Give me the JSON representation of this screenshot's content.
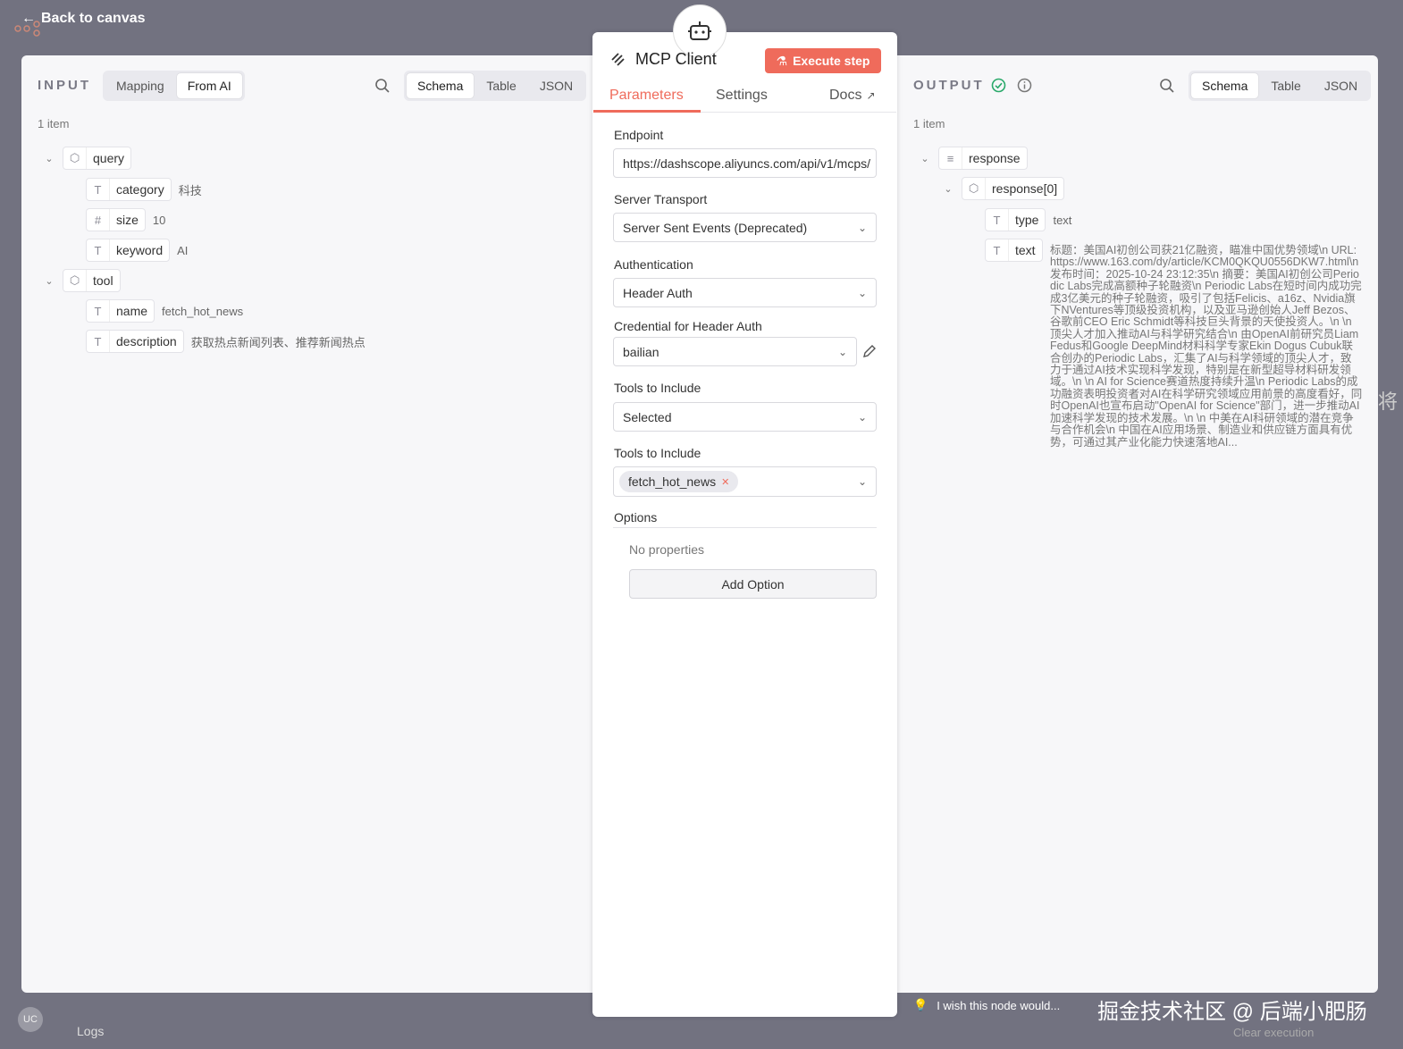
{
  "topbar": {
    "back_label": "Back to canvas"
  },
  "input": {
    "title": "INPUT",
    "mode_tabs": [
      "Mapping",
      "From AI"
    ],
    "view_tabs": [
      "Schema",
      "Table",
      "JSON"
    ],
    "items_count": "1 item",
    "tree": {
      "query": {
        "label": "query",
        "children": [
          {
            "type": "T",
            "name": "category",
            "value": "科技"
          },
          {
            "type": "#",
            "name": "size",
            "value": "10"
          },
          {
            "type": "T",
            "name": "keyword",
            "value": "AI"
          }
        ]
      },
      "tool": {
        "label": "tool",
        "children": [
          {
            "type": "T",
            "name": "name",
            "value": "fetch_hot_news"
          },
          {
            "type": "T",
            "name": "description",
            "value": "获取热点新闻列表、推荐新闻热点"
          }
        ]
      }
    }
  },
  "node": {
    "title": "MCP Client",
    "execute_label": "Execute step",
    "tabs": {
      "parameters": "Parameters",
      "settings": "Settings",
      "docs": "Docs"
    },
    "endpoint": {
      "label": "Endpoint",
      "value": "https://dashscope.aliyuncs.com/api/v1/mcps/"
    },
    "transport": {
      "label": "Server Transport",
      "value": "Server Sent Events (Deprecated)"
    },
    "auth": {
      "label": "Authentication",
      "value": "Header Auth"
    },
    "credential": {
      "label": "Credential for Header Auth",
      "value": "bailian"
    },
    "tools_mode": {
      "label": "Tools to Include",
      "value": "Selected"
    },
    "tools_selected": {
      "label": "Tools to Include",
      "chip": "fetch_hot_news"
    },
    "options": {
      "label": "Options",
      "empty": "No properties",
      "add_label": "Add Option"
    }
  },
  "output": {
    "title": "OUTPUT",
    "view_tabs": [
      "Schema",
      "Table",
      "JSON"
    ],
    "items_count": "1 item",
    "tree": {
      "response": "response",
      "response0": "response[0]",
      "type_name": "type",
      "type_value": "text",
      "text_name": "text",
      "text_value": "标题：美国AI初创公司获21亿融资，瞄准中国优势领域\\n URL: https://www.163.com/dy/article/KCM0QKQU0556DKW7.html\\n 发布时间：2025-10-24 23:12:35\\n 摘要：美国AI初创公司Periodic Labs完成高额种子轮融资\\n Periodic Labs在短时间内成功完成3亿美元的种子轮融资，吸引了包括Felicis、a16z、Nvidia旗下NVentures等顶级投资机构，以及亚马逊创始人Jeff Bezos、谷歌前CEO Eric Schmidt等科技巨头背景的天使投资人。\\n \\n 顶尖人才加入推动AI与科学研究结合\\n 由OpenAI前研究员Liam Fedus和Google DeepMind材料科学专家Ekin Dogus Cubuk联合创办的Periodic Labs，汇集了AI与科学领域的顶尖人才，致力于通过AI技术实现科学发现，特别是在新型超导材料研发领域。\\n \\n AI for Science赛道热度持续升温\\n Periodic Labs的成功融资表明投资者对AI在科学研究领域应用前景的高度看好，同时OpenAI也宣布启动\"OpenAI for Science\"部门，进一步推动AI加速科学发现的技术发展。\\n \\n 中美在AI科研领域的潜在竞争与合作机会\\n 中国在AI应用场景、制造业和供应链方面具有优势，可通过其产业化能力快速落地AI..."
    }
  },
  "footer": {
    "hint": "I wish this node would...",
    "watermark": "掘金技术社区 @ 后端小肥肠",
    "logs": "Logs",
    "clear": "Clear execution",
    "avatar": "UC"
  },
  "side_glyph": "将",
  "colors": {
    "accent": "#ef6b5b",
    "success": "#2aa96a",
    "backdrop": "#727280"
  }
}
